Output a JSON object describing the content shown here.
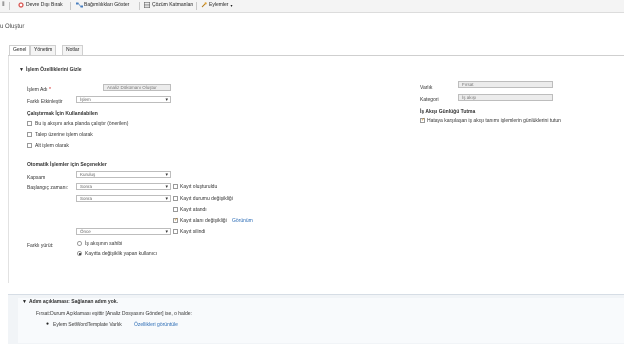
{
  "toolbar": {
    "items": [
      {
        "label": "Devre Dışı Bırak",
        "icon": "stop-circle-icon"
      },
      {
        "label": "Bağımlılıkları Göster",
        "icon": "dependencies-icon"
      },
      {
        "label": "Çözüm Katmanları",
        "icon": "layers-icon"
      },
      {
        "label": "Eylemler",
        "icon": "actions-icon"
      }
    ],
    "pin_glyph": "⫴"
  },
  "page": {
    "title": "u Oluştur"
  },
  "tabs": [
    "Genel",
    "Yönetim",
    "Notlar"
  ],
  "section": {
    "header": "İşlem Özelliklerini Gizle",
    "process_name_label": "İşlem Adı",
    "process_name_value": "Analiz Dökümanı Oluştur",
    "activate_as_label": "Farklı Etkinleştir",
    "activate_as_value": "İşlem",
    "entity_label": "Varlık",
    "entity_value": "Fırsat",
    "category_label": "Kategori",
    "category_value": "İş akışı",
    "available_header": "Çalıştırmak İçin Kullanılabilen",
    "available_opts": [
      {
        "label": "Bu iş akışını arka planda çalıştır (önerilen)",
        "checked": false
      },
      {
        "label": "Talep üzerine işlem olarak",
        "checked": false
      },
      {
        "label": "Alt işlem olarak",
        "checked": false
      }
    ],
    "log_header": "İş Akışı Günlüğü Tutma",
    "log_opt": {
      "label": "Hataya karşılaşan iş akışı tanımı işlemlerin günlüklerini tutun",
      "checked": true
    }
  },
  "auto": {
    "header": "Otomatik İşlemler için Seçenekler",
    "scope_label": "Kapsam",
    "scope_value": "Kuruluş",
    "start_label": "Başlangıç zamanı:",
    "start_rows": [
      {
        "select": "Sonra",
        "check_label": "Kayıt oluşturuldu",
        "checked": false,
        "link": ""
      },
      {
        "select": "Sonra",
        "check_label": "Kayıt durumu değişikliği",
        "checked": false,
        "link": ""
      },
      {
        "select": "",
        "check_label": "Kayıt atandı",
        "checked": false,
        "link": ""
      },
      {
        "select": "",
        "check_label": "Kayıt alanı değişikliği",
        "checked": true,
        "link": "Görünüm"
      },
      {
        "select": "Önce",
        "check_label": "Kayıt silindi",
        "checked": false,
        "link": ""
      }
    ],
    "run_as_label": "Farklı yürüt:",
    "run_as_opts": [
      {
        "label": "İş akışının sahibi",
        "on": false
      },
      {
        "label": "Kayıtta değişiklik yapan kullanıcı",
        "on": true
      }
    ]
  },
  "steps": {
    "header": "Adım açıklaması: Sağlanan adım yok.",
    "condition": "Fırsat:Durum Açıklaması eşittir [Analiz Dosyasını Gönder] ise, o halde:",
    "action_label": "Eylem",
    "action_name": "SetWordTemplate",
    "entity_label": "Varlık",
    "link": "Özellikleri görüntüle"
  }
}
